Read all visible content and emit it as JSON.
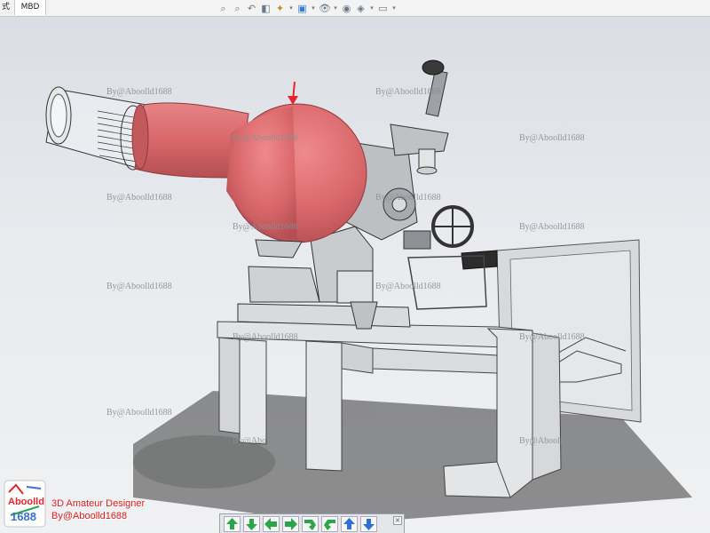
{
  "tabs": {
    "left_label": "式",
    "mbd_label": "MBD"
  },
  "hud_toolbar": {
    "icons": [
      "zoom-fit-icon",
      "zoom-area-icon",
      "previous-view-icon",
      "section-view-icon",
      "view-orientation-icon",
      "display-style-icon",
      "hide-show-icon",
      "edit-appearance-icon",
      "apply-scene-icon",
      "view-settings-icon"
    ]
  },
  "watermarks": [
    "By@Aboolld1688",
    "By@Aboolld1688",
    "By@Aboolld1688",
    "By@Aboolld1688",
    "By@Aboolld1688",
    "By@Aboolld1688",
    "By@Aboolld1688",
    "By@Aboolld1688",
    "By@Aboolld1688",
    "By@Aboolld1688",
    "By@Aboolld1688",
    "By@Aboolld1688",
    "By@Aboolld1688",
    "By@Aboolld1688",
    "By@Aboolld1688",
    "By@Aboolld1688",
    "By@Aboolld1688",
    "By@Aboolld1688"
  ],
  "logo": {
    "line1": "Aboolld",
    "line2": "1688"
  },
  "branding": {
    "line1": "3D Amateur Designer",
    "line2": "By@Aboolld1688"
  },
  "navigation": {
    "buttons": [
      "up-arrow-icon",
      "down-arrow-icon",
      "left-arrow-icon",
      "right-arrow-icon",
      "rotate-ccw-icon",
      "rotate-cw-icon",
      "previous-icon",
      "next-icon"
    ],
    "close_label": "×"
  },
  "colors": {
    "highlight_part": "#d9676a",
    "annotation_arrow": "#e8242b",
    "nav_green": "#2aa64a",
    "nav_blue": "#2e6fd8"
  }
}
